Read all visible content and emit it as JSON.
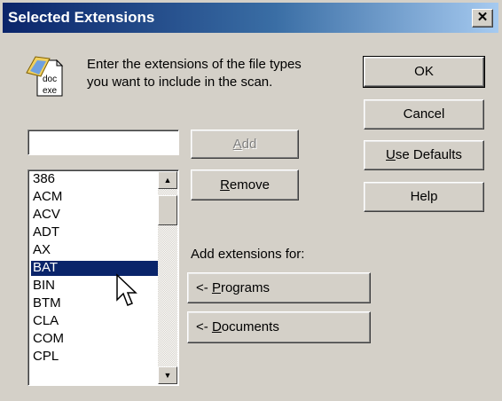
{
  "window": {
    "title": "Selected Extensions",
    "close_glyph": "✕"
  },
  "instructions": {
    "line1": "Enter the extensions of the file types",
    "line2": "you want to include in the scan.",
    "icon": "doc-exe-icon"
  },
  "buttons": {
    "ok": "OK",
    "cancel": "Cancel",
    "use_defaults_acc": "U",
    "use_defaults_rest": "se Defaults",
    "help": "Help",
    "add_acc": "A",
    "add_rest": "dd",
    "remove_acc": "R",
    "remove_rest": "emove",
    "programs_pre": "<- ",
    "programs_acc": "P",
    "programs_rest": "rograms",
    "documents_pre": "<- ",
    "documents_acc": "D",
    "documents_rest": "ocuments"
  },
  "extension_input": {
    "value": ""
  },
  "add_for_label": "Add extensions for:",
  "extensions": [
    "386",
    "ACM",
    "ACV",
    "ADT",
    "AX",
    "BAT",
    "BIN",
    "BTM",
    "CLA",
    "COM",
    "CPL"
  ],
  "selected_extension": "BAT",
  "scroll": {
    "up": "▲",
    "down": "▼"
  }
}
